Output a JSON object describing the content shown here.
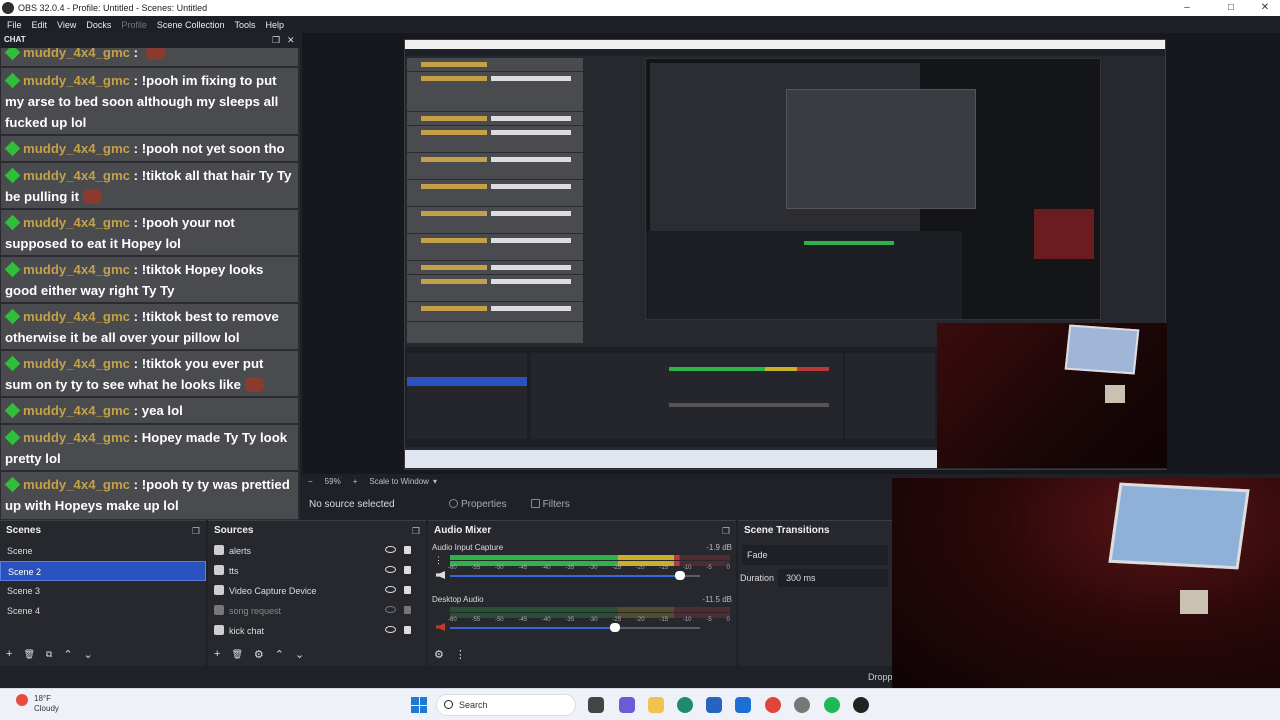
{
  "window": {
    "title": "OBS 32.0.4 - Profile: Untitled - Scenes: Untitled",
    "minimize": "–",
    "maximize": "□",
    "close": "✕"
  },
  "menu": {
    "file": "File",
    "edit": "Edit",
    "view": "View",
    "docks": "Docks",
    "profile": "Profile",
    "scene_collection": "Scene Collection",
    "tools": "Tools",
    "help": "Help"
  },
  "chat": {
    "title": "CHAT",
    "float": "❐",
    "close": "✕",
    "messages": [
      {
        "user": "muddy_4x4_gmc",
        "sep": " : ",
        "text": ""
      },
      {
        "user": "muddy_4x4_gmc",
        "sep": " : ",
        "text": "!pooh im fixing to put my arse to bed soon although my sleeps all fucked up lol"
      },
      {
        "user": "muddy_4x4_gmc",
        "sep": " : ",
        "text": "!pooh not yet soon tho"
      },
      {
        "user": "muddy_4x4_gmc",
        "sep": " : ",
        "text": "!tiktok all that hair Ty Ty be pulling it"
      },
      {
        "user": "muddy_4x4_gmc",
        "sep": " : ",
        "text": "!pooh your not supposed to eat it Hopey lol"
      },
      {
        "user": "muddy_4x4_gmc",
        "sep": " : ",
        "text": "!tiktok Hopey looks good either way right Ty Ty"
      },
      {
        "user": "muddy_4x4_gmc",
        "sep": " : ",
        "text": "!tiktok best to remove otherwise it be all over your pillow lol"
      },
      {
        "user": "muddy_4x4_gmc",
        "sep": " : ",
        "text": "!tiktok you ever put sum on ty ty to see what he looks like"
      },
      {
        "user": "muddy_4x4_gmc",
        "sep": " : ",
        "text": "yea lol"
      },
      {
        "user": "muddy_4x4_gmc",
        "sep": " : ",
        "text": "Hopey made Ty Ty look pretty lol"
      },
      {
        "user": "muddy_4x4_gmc",
        "sep": " : ",
        "text": "!pooh ty ty was prettied up with Hopeys make up lol"
      }
    ]
  },
  "preview": {
    "zoom_minus": "−",
    "zoom": "59%",
    "zoom_plus": "+",
    "scale_mode": "Scale to Window",
    "scale_arrow": "▾"
  },
  "props_bar": {
    "source_status": "No source selected",
    "properties": "Properties",
    "filters": "Filters"
  },
  "scenes": {
    "title": "Scenes",
    "items": [
      "Scene",
      "Scene 2",
      "Scene 3",
      "Scene 4"
    ],
    "selected": "Scene 2"
  },
  "sources": {
    "title": "Sources",
    "items": [
      {
        "name": "alerts",
        "visible": true
      },
      {
        "name": "tts",
        "visible": true
      },
      {
        "name": "Video Capture Device",
        "visible": true
      },
      {
        "name": "song request",
        "visible": false
      },
      {
        "name": "kick chat",
        "visible": true
      }
    ]
  },
  "dock_footer": {
    "add": "+",
    "remove": "🗑",
    "filter": "⧉",
    "up": "⌃",
    "down": "⌄",
    "settings": "⚙"
  },
  "mixer": {
    "title": "Audio Mixer",
    "scale": [
      "-60",
      "-55",
      "-50",
      "-45",
      "-40",
      "-35",
      "-30",
      "-25",
      "-20",
      "-15",
      "-10",
      "-5",
      "0"
    ],
    "channels": [
      {
        "name": "Audio Input Capture",
        "db": "-1.9 dB",
        "volume": 0.92,
        "level": 0.82
      },
      {
        "name": "Desktop Audio",
        "db": "-11.5 dB",
        "volume": 0.66,
        "level": 0.0
      }
    ],
    "gear": "⚙",
    "menu": "⋮"
  },
  "transitions": {
    "title": "Scene Transitions",
    "selected": "Fade",
    "duration_label": "Duration",
    "duration_value": "300 ms"
  },
  "statusbar": {
    "dropped": "Dropp"
  },
  "taskbar": {
    "temperature": "18°F",
    "condition": "Cloudy",
    "search": "Search"
  },
  "colors": {
    "accent": "#2a52be",
    "username": "#c4a148",
    "chat_bg": "#4a4b4f",
    "meter_green": "#2db34a",
    "meter_yellow": "#c8b02a",
    "meter_red": "#b83a3a"
  }
}
